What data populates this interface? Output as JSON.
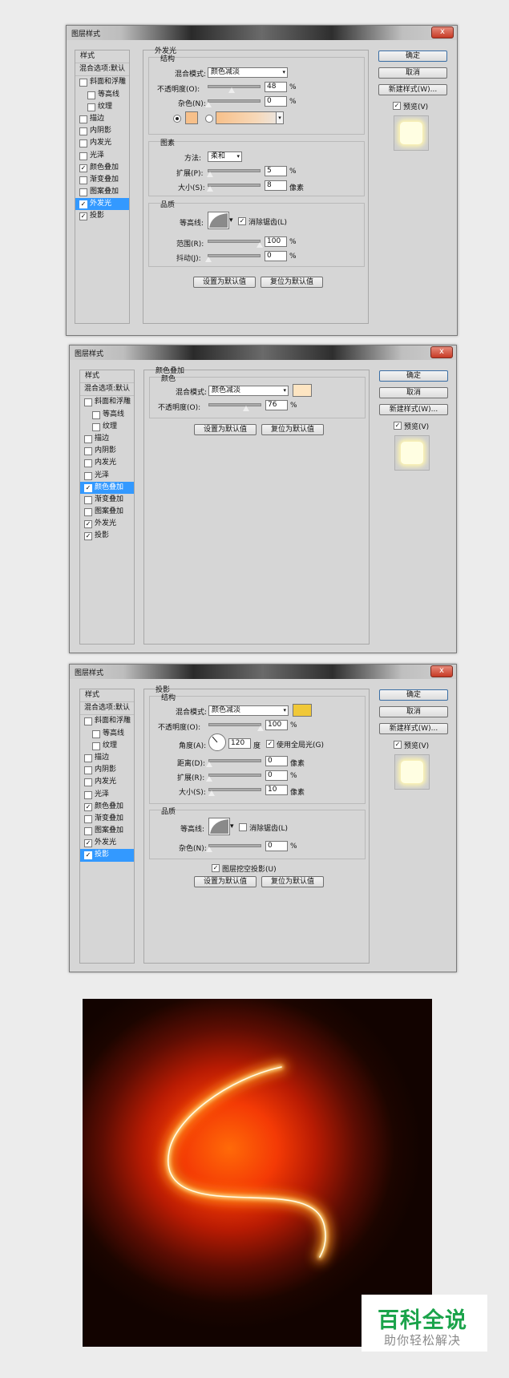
{
  "dialog_title": "图层样式",
  "left_panel": {
    "header": "样式",
    "blend": "混合选项:默认",
    "items": [
      "斜面和浮雕",
      "等高线",
      "纹理",
      "描边",
      "内阴影",
      "内发光",
      "光泽",
      "颜色叠加",
      "渐变叠加",
      "图案叠加",
      "外发光",
      "投影"
    ]
  },
  "buttons": {
    "ok": "确定",
    "cancel": "取消",
    "new_style": "新建样式(W)...",
    "preview": "预览(V)"
  },
  "common": {
    "set_default": "设置为默认值",
    "reset_default": "复位为默认值",
    "percent": "%",
    "pixels": "像素",
    "degrees": "度",
    "arrow": "▾",
    "check": "✓",
    "close": "x"
  },
  "dialogs": [
    {
      "section": "外发光",
      "structure": "结构",
      "blend_mode_label": "混合模式:",
      "blend_mode": "颜色减淡",
      "opacity_label": "不透明度(O):",
      "opacity": "48",
      "noise_label": "杂色(N):",
      "noise": "0",
      "glow_color": "#f7c08a",
      "elements": "图素",
      "method_label": "方法:",
      "method": "柔和",
      "spread_label": "扩展(P):",
      "spread": "5",
      "size_label": "大小(S):",
      "size": "8",
      "quality": "品质",
      "contour_label": "等高线:",
      "antialias": "消除锯齿(L)",
      "range_label": "范围(R):",
      "range": "100",
      "jitter_label": "抖动(J):",
      "jitter": "0"
    },
    {
      "section": "颜色叠加",
      "color": "颜色",
      "blend_mode_label": "混合模式:",
      "blend_mode": "颜色减淡",
      "overlay_color": "#fde5c2",
      "opacity_label": "不透明度(O):",
      "opacity": "76"
    },
    {
      "section": "投影",
      "structure": "结构",
      "blend_mode_label": "混合模式:",
      "blend_mode": "颜色减淡",
      "shadow_color": "#f0c838",
      "opacity_label": "不透明度(O):",
      "opacity": "100",
      "angle_label": "角度(A):",
      "angle": "120",
      "global_light": "使用全局光(G)",
      "distance_label": "距离(D):",
      "distance": "0",
      "spread_label": "扩展(R):",
      "spread": "0",
      "size_label": "大小(S):",
      "size": "10",
      "quality": "品质",
      "contour_label": "等高线:",
      "antialias": "消除锯齿(L)",
      "noise_label": "杂色(N):",
      "noise": "0",
      "knockout": "图层挖空投影(U)"
    }
  ],
  "logo": {
    "brand": "百科全说",
    "slogan": "助你轻松解决"
  }
}
